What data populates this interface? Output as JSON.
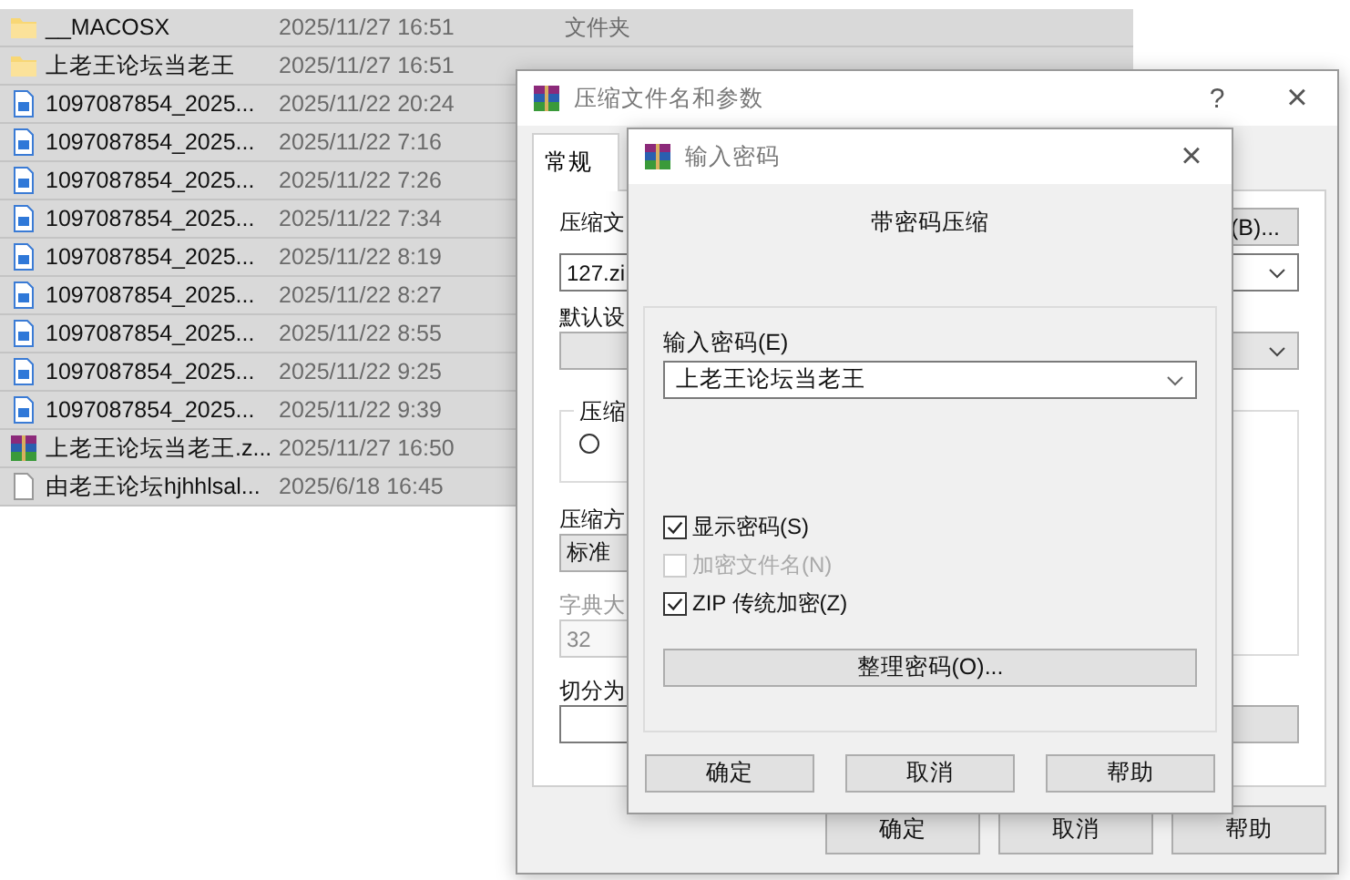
{
  "file_list": {
    "rows": [
      {
        "kind": "folder",
        "name": "__MACOSX",
        "date": "2025/11/27 16:51",
        "type": "文件夹"
      },
      {
        "kind": "folder",
        "name": "上老王论坛当老王",
        "date": "2025/11/27 16:51"
      },
      {
        "kind": "doc",
        "name": "1097087854_2025...",
        "date": "2025/11/22 20:24"
      },
      {
        "kind": "doc",
        "name": "1097087854_2025...",
        "date": "2025/11/22 7:16"
      },
      {
        "kind": "doc",
        "name": "1097087854_2025...",
        "date": "2025/11/22 7:26"
      },
      {
        "kind": "doc",
        "name": "1097087854_2025...",
        "date": "2025/11/22 7:34"
      },
      {
        "kind": "doc",
        "name": "1097087854_2025...",
        "date": "2025/11/22 8:19"
      },
      {
        "kind": "doc",
        "name": "1097087854_2025...",
        "date": "2025/11/22 8:27"
      },
      {
        "kind": "doc",
        "name": "1097087854_2025...",
        "date": "2025/11/22 8:55"
      },
      {
        "kind": "doc",
        "name": "1097087854_2025...",
        "date": "2025/11/22 9:25"
      },
      {
        "kind": "doc",
        "name": "1097087854_2025...",
        "date": "2025/11/22 9:39"
      },
      {
        "kind": "archive",
        "name": "上老王论坛当老王.z...",
        "date": "2025/11/27 16:50"
      },
      {
        "kind": "file",
        "name": "由老王论坛hjhhlsal...",
        "date": "2025/6/18 16:45"
      }
    ]
  },
  "archive_dialog": {
    "title": "压缩文件名和参数",
    "help": "?",
    "close": "×",
    "tabs": [
      {
        "label": "常规",
        "selected": true
      }
    ],
    "archive_name_label": "压缩文",
    "browse_button": "(B)...",
    "archive_name_value": "127.zi",
    "profile_label": "默认设",
    "format_group_label": "压缩",
    "format_radio": {
      "selected": false
    },
    "method_label": "压缩方",
    "method_value": "标准",
    "dictionary_label": "字典大",
    "dictionary_value": "32",
    "split_label": "切分为",
    "buttons": [
      "确定",
      "取消",
      "帮助"
    ]
  },
  "password_dialog": {
    "title": "输入密码",
    "close": "×",
    "heading": "带密码压缩",
    "password_label": "输入密码(E)",
    "password_value": "上老王论坛当老王",
    "options": [
      {
        "label": "显示密码(S)",
        "checked": true,
        "disabled": false
      },
      {
        "label": "加密文件名(N)",
        "checked": false,
        "disabled": true
      },
      {
        "label": "ZIP 传统加密(Z)",
        "checked": true,
        "disabled": false
      }
    ],
    "organize_button": "整理密码(O)...",
    "buttons": [
      "确定",
      "取消",
      "帮助"
    ]
  }
}
